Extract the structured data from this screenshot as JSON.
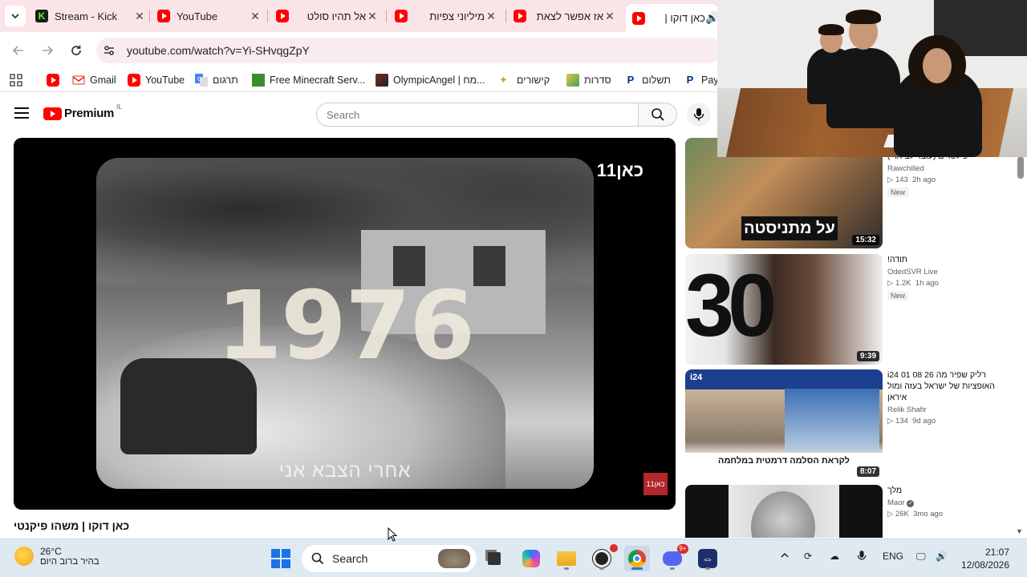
{
  "browser": {
    "tabs": [
      {
        "title": "Stream - Kick",
        "icon": "kick-icon",
        "active": false
      },
      {
        "title": "YouTube",
        "icon": "youtube-icon",
        "active": false
      },
      {
        "title": "אל תהיו סולט",
        "icon": "youtube-icon",
        "active": false
      },
      {
        "title": "מיליוני צפיות",
        "icon": "youtube-icon",
        "active": false
      },
      {
        "title": "אז אפשר לצאת",
        "icon": "youtube-icon",
        "active": false
      },
      {
        "title": "כאן דוקו |",
        "icon": "youtube-icon",
        "active": true
      }
    ],
    "url": "youtube.com/watch?v=Yi-SHvqgZpY",
    "bookmarks": [
      {
        "label": "",
        "icon": "youtube-icon"
      },
      {
        "label": "Gmail",
        "icon": "gmail-icon"
      },
      {
        "label": "YouTube",
        "icon": "youtube-icon"
      },
      {
        "label": "תרגום",
        "icon": "translate-icon"
      },
      {
        "label": "Free Minecraft Serv...",
        "icon": "minecraft-icon"
      },
      {
        "label": "OlympicAngel | מח...",
        "icon": "avatar-icon"
      },
      {
        "label": "קישורים",
        "icon": "folder-icon"
      },
      {
        "label": "סדרות",
        "icon": "folder-icon"
      },
      {
        "label": "תשלום",
        "icon": "paypal-icon"
      },
      {
        "label": "PayP",
        "icon": "paypal-icon"
      }
    ]
  },
  "youtube": {
    "logo_text": "Premium",
    "country_code": "IL",
    "search_placeholder": "Search",
    "video": {
      "year_overlay": "1976",
      "subtitle": "אחרי הצבא אני",
      "channel_watermark": "כאן11",
      "badge": "כאן11",
      "title": "כאן דוקו | משהו פיקנטי"
    },
    "recommendations": [
      {
        "title": "פילטרים (עובד לב ארי)",
        "channel": "Rawchilled",
        "views": "143",
        "age": "2h ago",
        "badge": "New",
        "duration": "15:32"
      },
      {
        "title": "תודה!",
        "channel": "OdedSVR Live",
        "views": "1.2K",
        "age": "1h ago",
        "badge": "New",
        "duration": "9:39"
      },
      {
        "title": "רליק שפיר  מה 26 08 01  i24 האופציות של ישראל בעזה ומול איראן",
        "channel": "Relik Shafir",
        "views": "134",
        "age": "9d ago",
        "badge": "",
        "duration": "8:07"
      },
      {
        "title": "מלך",
        "channel": "Maor",
        "views": "26K",
        "age": "3mo ago",
        "badge": "",
        "duration": ""
      }
    ]
  },
  "taskbar": {
    "temperature": "26°C",
    "weather_text": "בהיר ברוב היום",
    "search_label": "Search",
    "language": "ENG",
    "time": "21:07",
    "date": "12/08/2026",
    "discord_badge": "9+"
  },
  "colors": {
    "tabstrip": "#fbe4e8",
    "youtube_red": "#ff0000",
    "taskbar": "#dfe9f2"
  }
}
